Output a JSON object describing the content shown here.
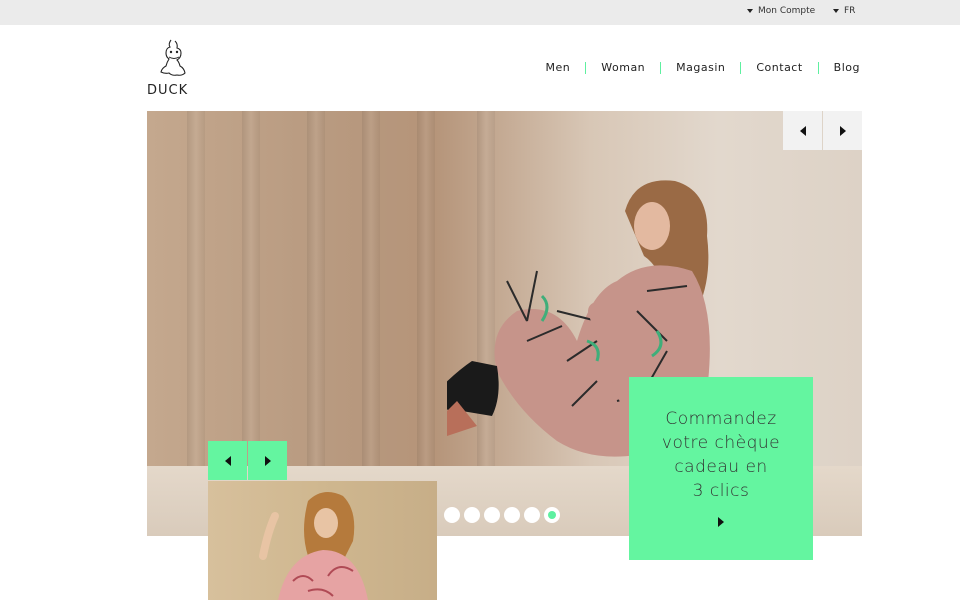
{
  "topbar": {
    "account_label": "Mon Compte",
    "language_label": "FR"
  },
  "brand": {
    "name": "DUCK"
  },
  "nav": {
    "items": [
      {
        "label": "Men"
      },
      {
        "label": "Woman"
      },
      {
        "label": "Magasin"
      },
      {
        "label": "Contact"
      },
      {
        "label": "Blog"
      }
    ]
  },
  "hero": {
    "image": "model-sitting-in-patterned-dress-photo",
    "prev_icon": "arrow-left-icon",
    "next_icon": "arrow-right-icon",
    "slides_count": 6,
    "active_slide": 6
  },
  "gift_card": {
    "lines": [
      "Commandez",
      "votre chèque",
      "cadeau en",
      "3 clics"
    ],
    "arrow_icon": "arrow-right-icon"
  },
  "mini_slider": {
    "image": "laughing-woman-floral-blouse-photo",
    "prev_icon": "arrow-left-icon",
    "next_icon": "arrow-right-icon"
  },
  "colors": {
    "accent": "#64f5a0",
    "topbar_bg": "#ebebeb",
    "text": "#222222"
  }
}
